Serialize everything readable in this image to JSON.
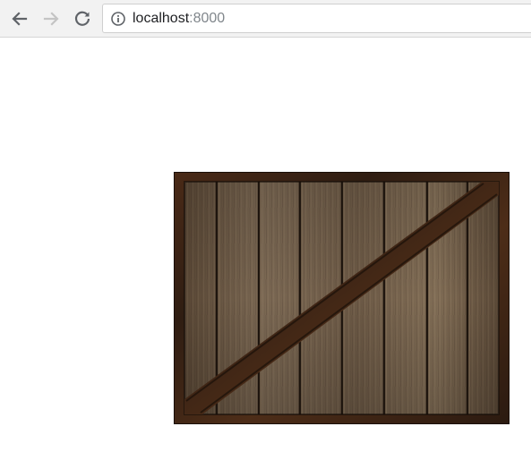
{
  "browser": {
    "url_host": "localhost",
    "url_port": ":8000",
    "icons": {
      "back": "back-arrow-icon",
      "forward": "forward-arrow-icon",
      "reload": "reload-icon",
      "site_info": "info-icon"
    }
  },
  "colors": {
    "toolbar_bg": "#f2f2f2",
    "wood_light": "#7a6752",
    "wood_dark": "#4f3f30",
    "frame_rust": "#3d2415"
  }
}
